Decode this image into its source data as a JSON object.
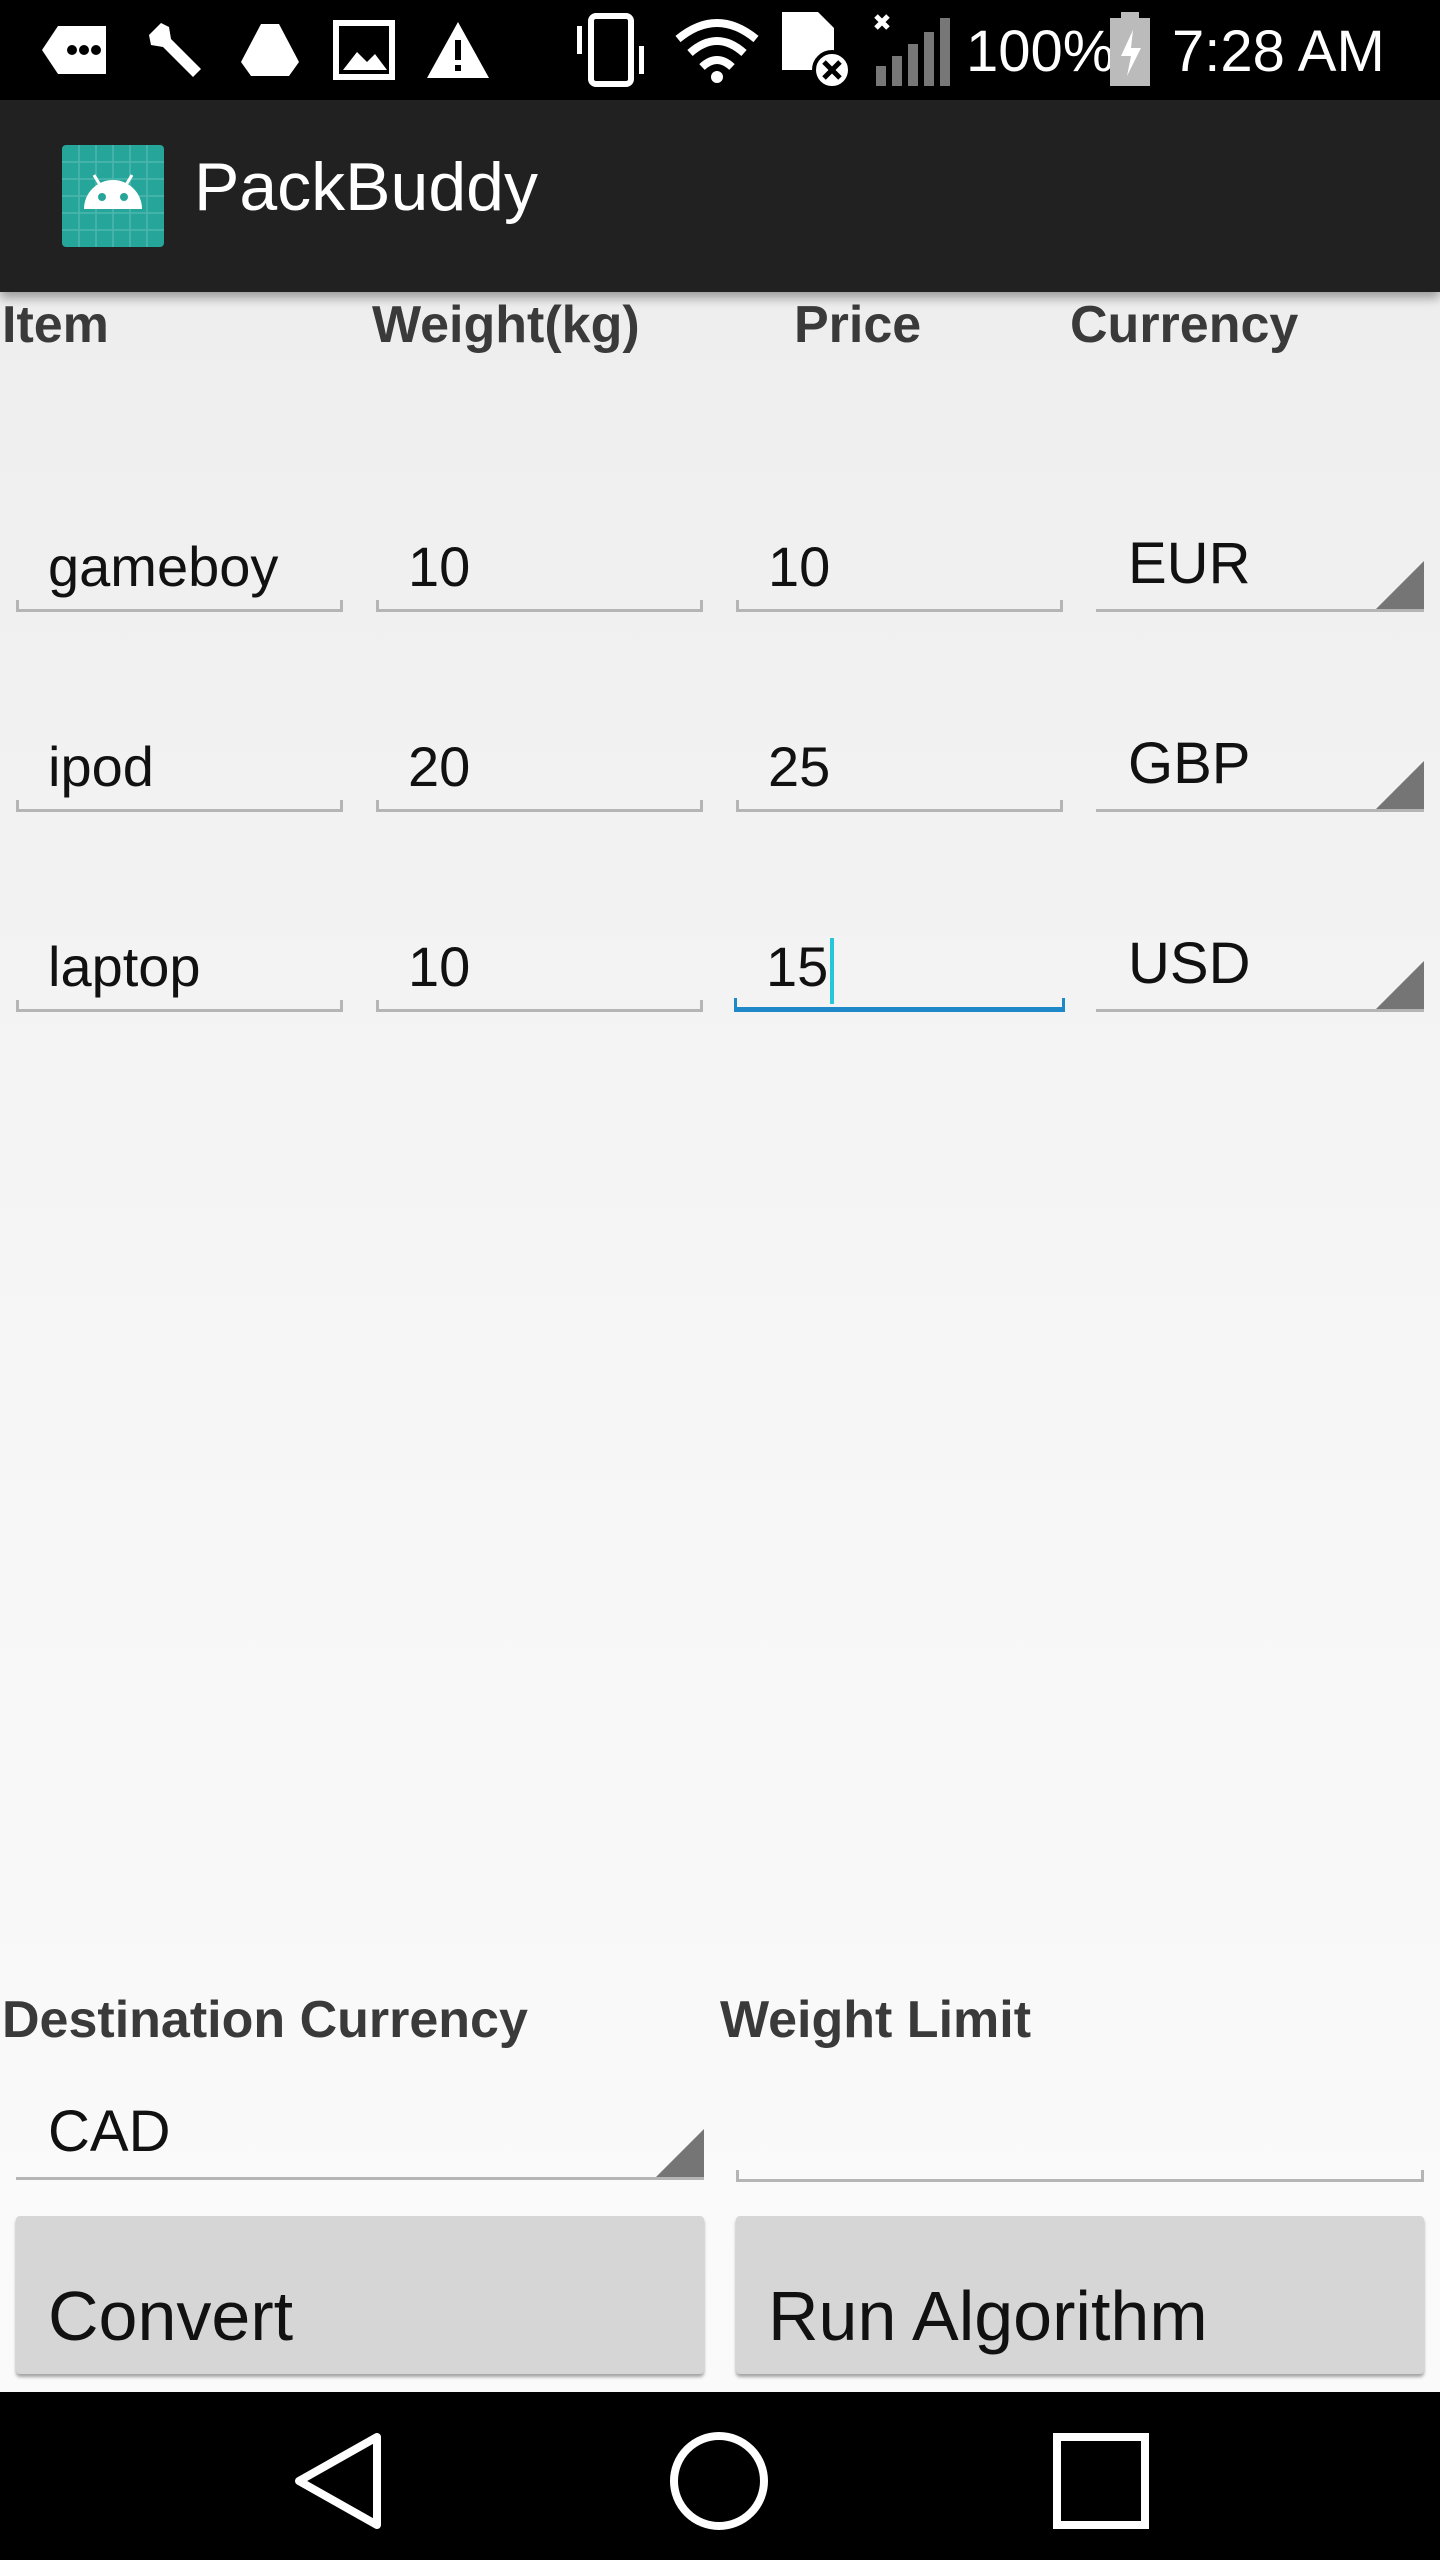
{
  "status_bar": {
    "battery": "100%",
    "time": "7:28 AM",
    "icons": [
      "message-icon",
      "wrench-icon",
      "drive-icon",
      "image-icon",
      "warning-icon",
      "vibrate-icon",
      "wifi-icon",
      "no-sim-icon",
      "signal-icon",
      "battery-charging-icon"
    ]
  },
  "app": {
    "title": "PackBuddy",
    "logo_icon": "android-icon",
    "accent_color": "#26a69a",
    "focus_color": "#1e88c8"
  },
  "table": {
    "headers": [
      "Item",
      "Weight(kg)",
      "Price",
      "Currency"
    ],
    "rows": [
      {
        "item": "gameboy",
        "weight": "10",
        "price": "10",
        "currency": "EUR"
      },
      {
        "item": "ipod",
        "weight": "20",
        "price": "25",
        "currency": "GBP"
      },
      {
        "item": "laptop",
        "weight": "10",
        "price": "15",
        "currency": "USD"
      }
    ]
  },
  "bottom": {
    "destination_label": "Destination Currency",
    "destination_value": "CAD",
    "weight_limit_label": "Weight Limit",
    "weight_limit_value": "",
    "convert_label": "Convert",
    "run_label": "Run Algorithm"
  },
  "nav": {
    "icons": [
      "back-icon",
      "home-icon",
      "recents-icon"
    ]
  }
}
